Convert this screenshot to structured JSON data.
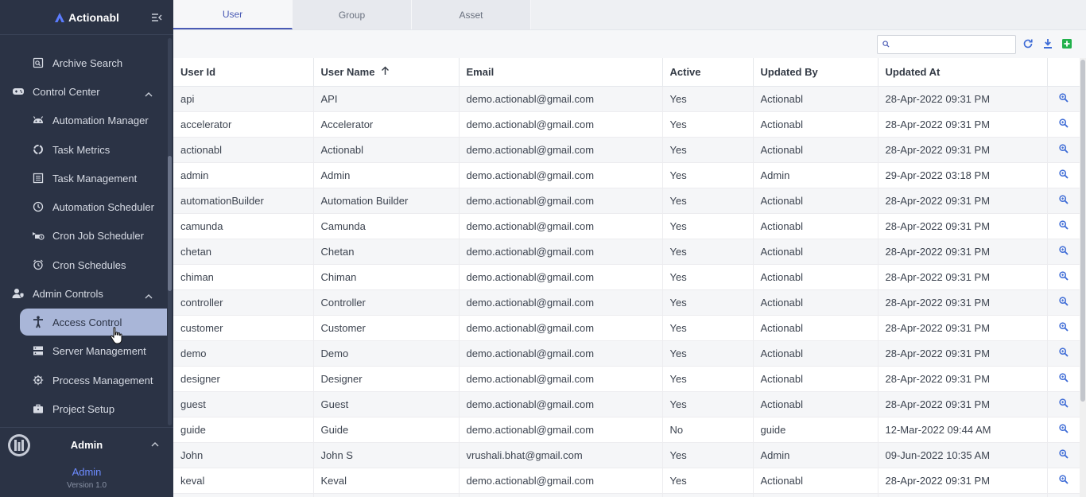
{
  "brand": {
    "name": "Actionabl"
  },
  "sidebar": {
    "items": [
      {
        "label": "Archive Search",
        "icon": "archive-search-icon",
        "type": "item"
      },
      {
        "label": "Control Center",
        "icon": "gamepad-icon",
        "type": "section"
      },
      {
        "label": "Automation Manager",
        "icon": "robot-icon",
        "type": "item"
      },
      {
        "label": "Task Metrics",
        "icon": "donut-icon",
        "type": "item"
      },
      {
        "label": "Task Management",
        "icon": "list-icon",
        "type": "item"
      },
      {
        "label": "Automation Scheduler",
        "icon": "clock-icon",
        "type": "item"
      },
      {
        "label": "Cron Job Scheduler",
        "icon": "scheduler-icon",
        "type": "item"
      },
      {
        "label": "Cron Schedules",
        "icon": "alarm-icon",
        "type": "item"
      },
      {
        "label": "Admin Controls",
        "icon": "admin-icon",
        "type": "section"
      },
      {
        "label": "Access Control",
        "icon": "accessibility-icon",
        "type": "item"
      },
      {
        "label": "Server Management",
        "icon": "server-icon",
        "type": "item"
      },
      {
        "label": "Process Management",
        "icon": "process-icon",
        "type": "item"
      },
      {
        "label": "Project Setup",
        "icon": "briefcase-icon",
        "type": "item"
      }
    ],
    "active": "Access Control"
  },
  "user": {
    "name": "Admin",
    "role": "Admin",
    "version": "Version 1.0"
  },
  "tabs": [
    {
      "label": "User",
      "active": true
    },
    {
      "label": "Group",
      "active": false
    },
    {
      "label": "Asset",
      "active": false
    }
  ],
  "search": {
    "placeholder": "",
    "value": ""
  },
  "table": {
    "columns": [
      "User Id",
      "User Name",
      "Email",
      "Active",
      "Updated By",
      "Updated At"
    ],
    "sorted_column": "User Name",
    "rows": [
      [
        "api",
        "API",
        "demo.actionabl@gmail.com",
        "Yes",
        "Actionabl",
        "28-Apr-2022 09:31 PM"
      ],
      [
        "accelerator",
        "Accelerator",
        "demo.actionabl@gmail.com",
        "Yes",
        "Actionabl",
        "28-Apr-2022 09:31 PM"
      ],
      [
        "actionabl",
        "Actionabl",
        "demo.actionabl@gmail.com",
        "Yes",
        "Actionabl",
        "28-Apr-2022 09:31 PM"
      ],
      [
        "admin",
        "Admin",
        "demo.actionabl@gmail.com",
        "Yes",
        "Admin",
        "29-Apr-2022 03:18 PM"
      ],
      [
        "automationBuilder",
        "Automation Builder",
        "demo.actionabl@gmail.com",
        "Yes",
        "Actionabl",
        "28-Apr-2022 09:31 PM"
      ],
      [
        "camunda",
        "Camunda",
        "demo.actionabl@gmail.com",
        "Yes",
        "Actionabl",
        "28-Apr-2022 09:31 PM"
      ],
      [
        "chetan",
        "Chetan",
        "demo.actionabl@gmail.com",
        "Yes",
        "Actionabl",
        "28-Apr-2022 09:31 PM"
      ],
      [
        "chiman",
        "Chiman",
        "demo.actionabl@gmail.com",
        "Yes",
        "Actionabl",
        "28-Apr-2022 09:31 PM"
      ],
      [
        "controller",
        "Controller",
        "demo.actionabl@gmail.com",
        "Yes",
        "Actionabl",
        "28-Apr-2022 09:31 PM"
      ],
      [
        "customer",
        "Customer",
        "demo.actionabl@gmail.com",
        "Yes",
        "Actionabl",
        "28-Apr-2022 09:31 PM"
      ],
      [
        "demo",
        "Demo",
        "demo.actionabl@gmail.com",
        "Yes",
        "Actionabl",
        "28-Apr-2022 09:31 PM"
      ],
      [
        "designer",
        "Designer",
        "demo.actionabl@gmail.com",
        "Yes",
        "Actionabl",
        "28-Apr-2022 09:31 PM"
      ],
      [
        "guest",
        "Guest",
        "demo.actionabl@gmail.com",
        "Yes",
        "Actionabl",
        "28-Apr-2022 09:31 PM"
      ],
      [
        "guide",
        "Guide",
        "demo.actionabl@gmail.com",
        "No",
        "guide",
        "12-Mar-2022 09:44 AM"
      ],
      [
        "John",
        "John S",
        "vrushali.bhat@gmail.com",
        "Yes",
        "Admin",
        "09-Jun-2022 10:35 AM"
      ],
      [
        "keval",
        "Keval",
        "demo.actionabl@gmail.com",
        "Yes",
        "Actionabl",
        "28-Apr-2022 09:31 PM"
      ],
      [
        "",
        "",
        "",
        "",
        "",
        ""
      ]
    ]
  },
  "colors": {
    "sidebar_bg": "#2b3345",
    "accent": "#4a5bb5",
    "active_item_bg": "#a9b6d8",
    "add_green": "#22b14c",
    "role_blue": "#6d8bff"
  }
}
